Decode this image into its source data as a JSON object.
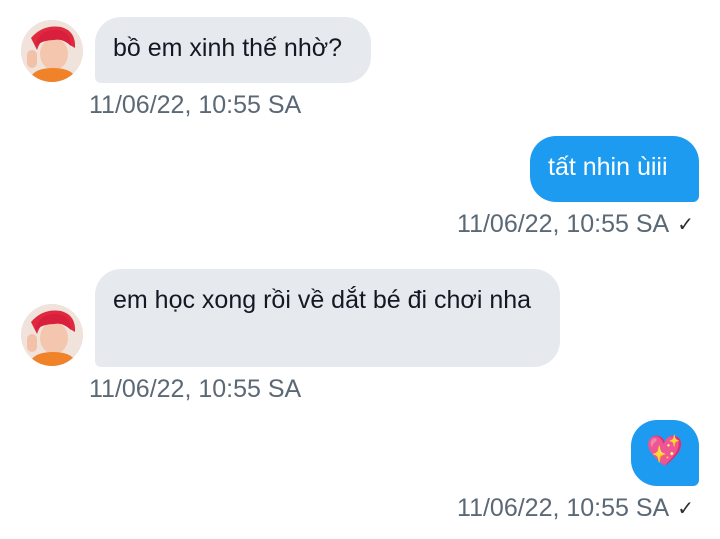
{
  "messages": [
    {
      "direction": "incoming",
      "text": "bồ em xinh thế nhờ?",
      "time": "11/06/22, 10:55 SA"
    },
    {
      "direction": "outgoing",
      "text": "tất nhin ùiii",
      "time": "11/06/22, 10:55 SA",
      "status_icon": "✓"
    },
    {
      "direction": "incoming",
      "text": "em học xong rồi về dắt bé đi chơi nha",
      "time": "11/06/22, 10:55 SA"
    },
    {
      "direction": "outgoing",
      "emoji": "💖",
      "time": "11/06/22, 10:55 SA",
      "status_icon": "✓"
    }
  ],
  "icons": {
    "avatar": "avatar-photo",
    "sent_status": "checkmark-icon",
    "sparkling_heart": "sparkling-heart-icon"
  },
  "colors": {
    "incoming_bubble": "#e6eaee",
    "outgoing_bubble": "#1d9bf0",
    "timestamp": "#5b6875"
  }
}
